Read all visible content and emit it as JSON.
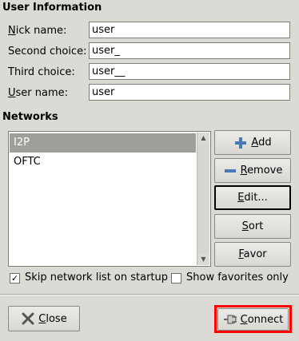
{
  "user_info": {
    "title": "User Information",
    "nick": {
      "label_mn": "N",
      "label_rest": "ick name:",
      "value": "user"
    },
    "second": {
      "label": "Second choice:",
      "value": "user_"
    },
    "third": {
      "label": "Third choice:",
      "value": "user__"
    },
    "username": {
      "label_mn": "U",
      "label_rest": "ser name:",
      "value": "user"
    }
  },
  "networks": {
    "title": "Networks",
    "items": [
      "I2P",
      "OFTC"
    ],
    "selected": "I2P"
  },
  "buttons": {
    "add_mn": "A",
    "add_rest": "dd",
    "remove_mn": "R",
    "remove_rest": "emove",
    "edit_mn": "E",
    "edit_rest": "dit...",
    "sort_mn": "S",
    "sort_rest": "ort",
    "favor_mn": "F",
    "favor_rest": "avor",
    "close_mn": "C",
    "close_rest": "lose",
    "connect_mn": "C",
    "connect_rest": "onnect"
  },
  "options": {
    "skip_list": {
      "label": "Skip network list on startup",
      "checked": true
    },
    "show_favorites": {
      "label": "Show favorites only",
      "checked": false
    }
  },
  "colors": {
    "highlight": "#ff0000",
    "selected_row": "#a09e99"
  }
}
